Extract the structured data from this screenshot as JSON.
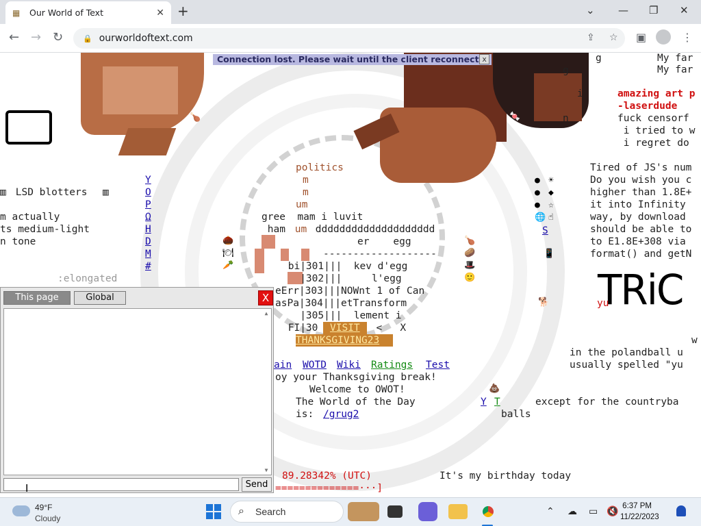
{
  "browser": {
    "tab_title": "Our World of Text",
    "url": "ourworldoftext.com"
  },
  "banner": {
    "message": "Connection lost. Please wait until the client reconnects.",
    "close": "x"
  },
  "world": {
    "top_right_1": "My far",
    "top_right_2": "My far",
    "g1": "g",
    "g2": "g",
    "i1": "i",
    "n1": "n",
    "art1": "amazing art p",
    "art2": "-laserdude",
    "fuck": "fuck censorf",
    "tried": " i tried to w",
    "regret": " i regret do",
    "js1": "Tired of JS's num",
    "js2": "Do you wish you c",
    "js3": "higher than 1.8E+",
    "js4": "it into Infinity",
    "js5": "way, by download",
    "js6": "should be able to",
    "js7": "to E1.8E+308 via",
    "js8": "format() and getN",
    "lsd": " LSD blotters ",
    "actually": "m actually",
    "medium": "ts medium-light",
    "tone": "n tone",
    "elongated": ":elongated",
    "vert_links": [
      "Y",
      "O",
      "P",
      "Ω",
      "H",
      "D",
      "M",
      "#"
    ],
    "politics": "politics",
    "m1": "m",
    "m2": "m",
    "um": "um",
    "gree": "gree  mam i luvit",
    "ham_a": " ham",
    "ham_b": " um",
    "ham_c": " dddddddddddddddddddd",
    "er_egg": "er    egg",
    "dashes": "-------------------",
    "row1": " bi|301|||  kev d'egg",
    "row2": "   |302|||     l'egg",
    "row3": "eErr|303|||NOWnt 1 of Can",
    "row4": "asPa|304|||etTransform",
    "row5": "   |305|||  lement i",
    "row6a": " FI|30",
    "visit": "VISIT",
    "row6b": "  <   X",
    "thanksgiving": "THANKSGIVING23",
    "nav_main": "ain",
    "nav_wotd": "WOTD",
    "nav_wiki": "Wiki",
    "nav_ratings": "Ratings",
    "nav_test": "Test",
    "enjoy": "oy your Thanksgiving break!",
    "welcome": "Welcome to OWOT!",
    "wotd_line": "The World of the Day",
    "is": "is:",
    "grug": "/grug2",
    "pct": "89.28342% (UTC)",
    "birthday": "It's my birthday today",
    "bar": "==============···]",
    "tric": "TRiC",
    "yu": "yu",
    "w": "w",
    "polandball": "in the polandball u",
    "usually": "usually spelled \"yu",
    "yt_y": "Y",
    "yt_t": "T",
    "except": "except for the countryba",
    "balls": "balls",
    "s_link": "S"
  },
  "chat": {
    "tab_page": "This page",
    "tab_global": "Global",
    "close": "X",
    "input_value": "",
    "send": "Send"
  },
  "taskbar": {
    "temp": "49°F",
    "condition": "Cloudy",
    "search": "Search",
    "time": "6:37 PM",
    "date": "11/22/2023"
  }
}
